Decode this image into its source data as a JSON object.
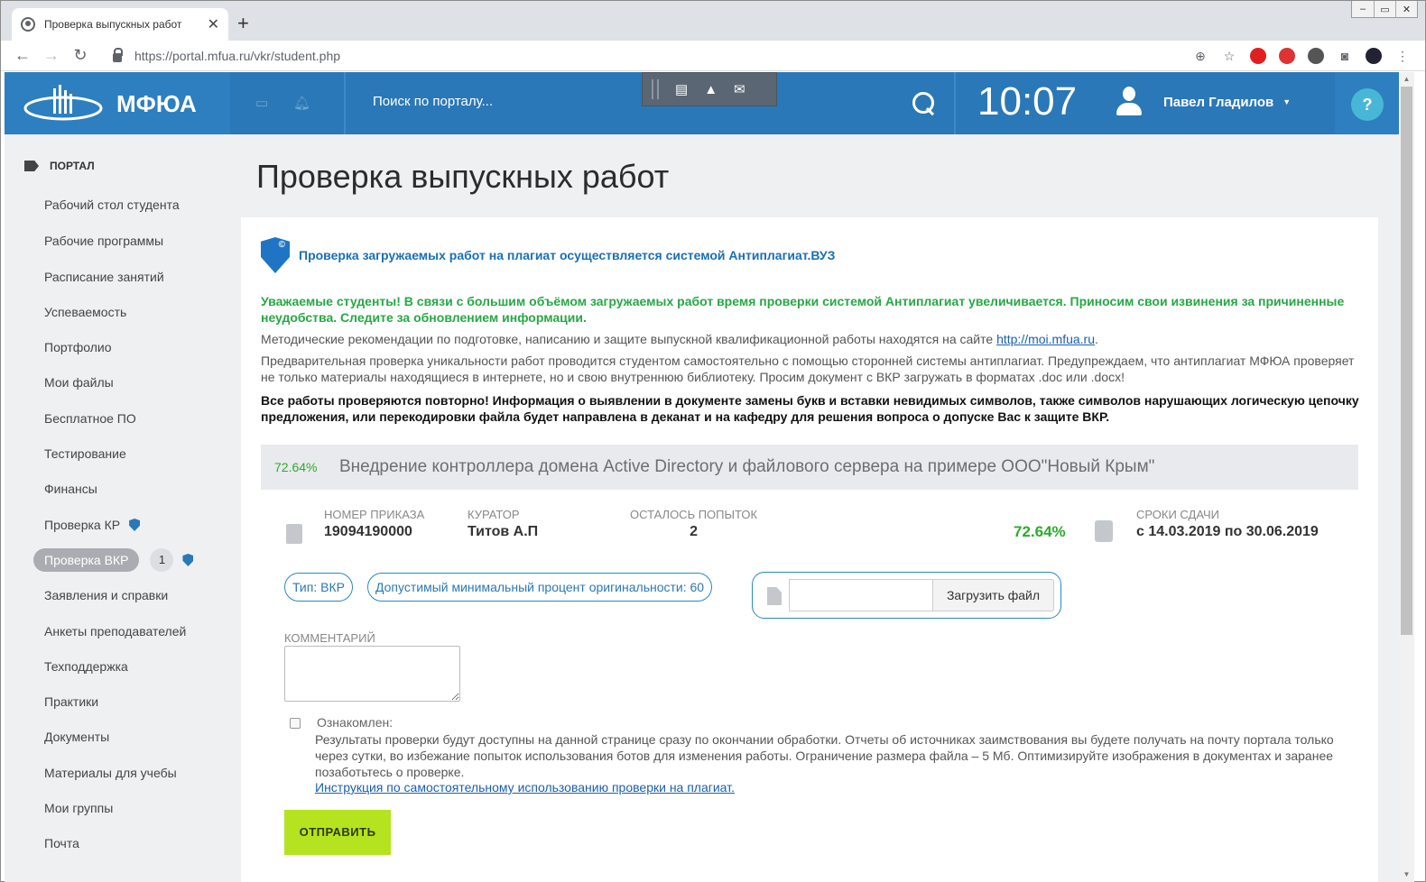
{
  "browser": {
    "tab_title": "Проверка выпускных работ",
    "tab_close": "✕",
    "new_tab": "+",
    "url_host": "https://portal.mfua.ru",
    "url_path": "/vkr/student.php",
    "window_controls": [
      "–",
      "▭",
      "✕"
    ]
  },
  "header": {
    "brand": "МФЮА",
    "search_placeholder": "Поиск по порталу...",
    "time": "10:07",
    "user_name": "Павел Гладилов",
    "help": "?"
  },
  "sidebar": {
    "section": "ПОРТАЛ",
    "items": [
      {
        "label": "Рабочий стол студента"
      },
      {
        "label": "Рабочие программы"
      },
      {
        "label": "Расписание занятий"
      },
      {
        "label": "Успеваемость"
      },
      {
        "label": "Портфолио"
      },
      {
        "label": "Мои файлы"
      },
      {
        "label": "Бесплатное ПО"
      },
      {
        "label": "Тестирование"
      },
      {
        "label": "Финансы"
      },
      {
        "label": "Проверка КР"
      },
      {
        "label": "Проверка ВКР",
        "count": "1"
      },
      {
        "label": "Заявления и справки"
      },
      {
        "label": "Анкеты преподавателей"
      },
      {
        "label": "Техподдержка"
      },
      {
        "label": "Практики"
      },
      {
        "label": "Документы"
      },
      {
        "label": "Материалы для учебы"
      },
      {
        "label": "Мои группы"
      },
      {
        "label": "Почта"
      }
    ]
  },
  "main": {
    "title": "Проверка выпускных работ",
    "antiplagiat_notice": "Проверка загружаемых работ на плагиат осуществляется системой Антиплагиат.ВУЗ",
    "warning": "Уважаемые студенты! В связи с большим объёмом загружаемых работ время проверки системой Антиплагиат увеличивается. Приносим свои извинения за причиненные неудобства. Следите за обновлением информации.",
    "method_text": "Методические рекомендации по подготовке, написанию и защите выпускной квалификационной работы находятся на сайте",
    "method_link": "http://moi.mfua.ru",
    "method_end": ".",
    "precheck": "Предварительная проверка уникальности работ проводится студентом самостоятельно с помощью сторонней системы антиплагиат. Предупреждаем, что антиплагиат МФЮА проверяет не только материалы находящиеся в интернете, но и свою внутреннюю библиотеку. Просим документ с ВКР загружать в форматах .doc или .docx!",
    "recheck": "Все работы проверяются повторно! Информация о выявлении в документе замены букв и вставки невидимых символов, также символов нарушающих логическую цепочку предложения, или перекодировки файла будет направлена в деканат и на кафедру для решения вопроса о допуске Вас к защите ВКР.",
    "work": {
      "percent": "72.64%",
      "title": "Внедрение контроллера домена Active Directory и файлового сервера на примере ООО\"Новый Крым\"",
      "order_label": "НОМЕР ПРИКАЗА",
      "order_value": "19094190000",
      "curator_label": "КУРАТОР",
      "curator_value": "Титов А.П",
      "attempts_label": "ОСТАЛОСЬ ПОПЫТОК",
      "attempts_value": "2",
      "big_percent": "72.64%",
      "deadline_label": "СРОКИ СДАЧИ",
      "deadline_value": "с 14.03.2019 по 30.06.2019",
      "type_chip": "Тип: ВКР",
      "min_chip": "Допустимый минимальный процент оригинальности: 60",
      "upload_button": "Загрузить файл"
    },
    "comment_label": "КОММЕНТАРИЙ",
    "agree_label": "Ознакомлен:",
    "note": "Результаты проверки будут доступны на данной странице сразу по окончании обработки. Отчеты об источниках заимствования вы будете получать на почту портала только через сутки, во избежание попыток использования ботов для изменения работы. Ограничение размера файла – 5 Мб. Оптимизируйте изображения в документах и заранее позаботьтесь о проверке.",
    "instruction_link": "Инструкция по самостоятельному использованию проверки на плагиат.",
    "submit": "ОТПРАВИТЬ"
  },
  "colors": {
    "header_blue": "#2a78b7",
    "green_text": "#27a844",
    "submit_green": "#b6e31f"
  }
}
